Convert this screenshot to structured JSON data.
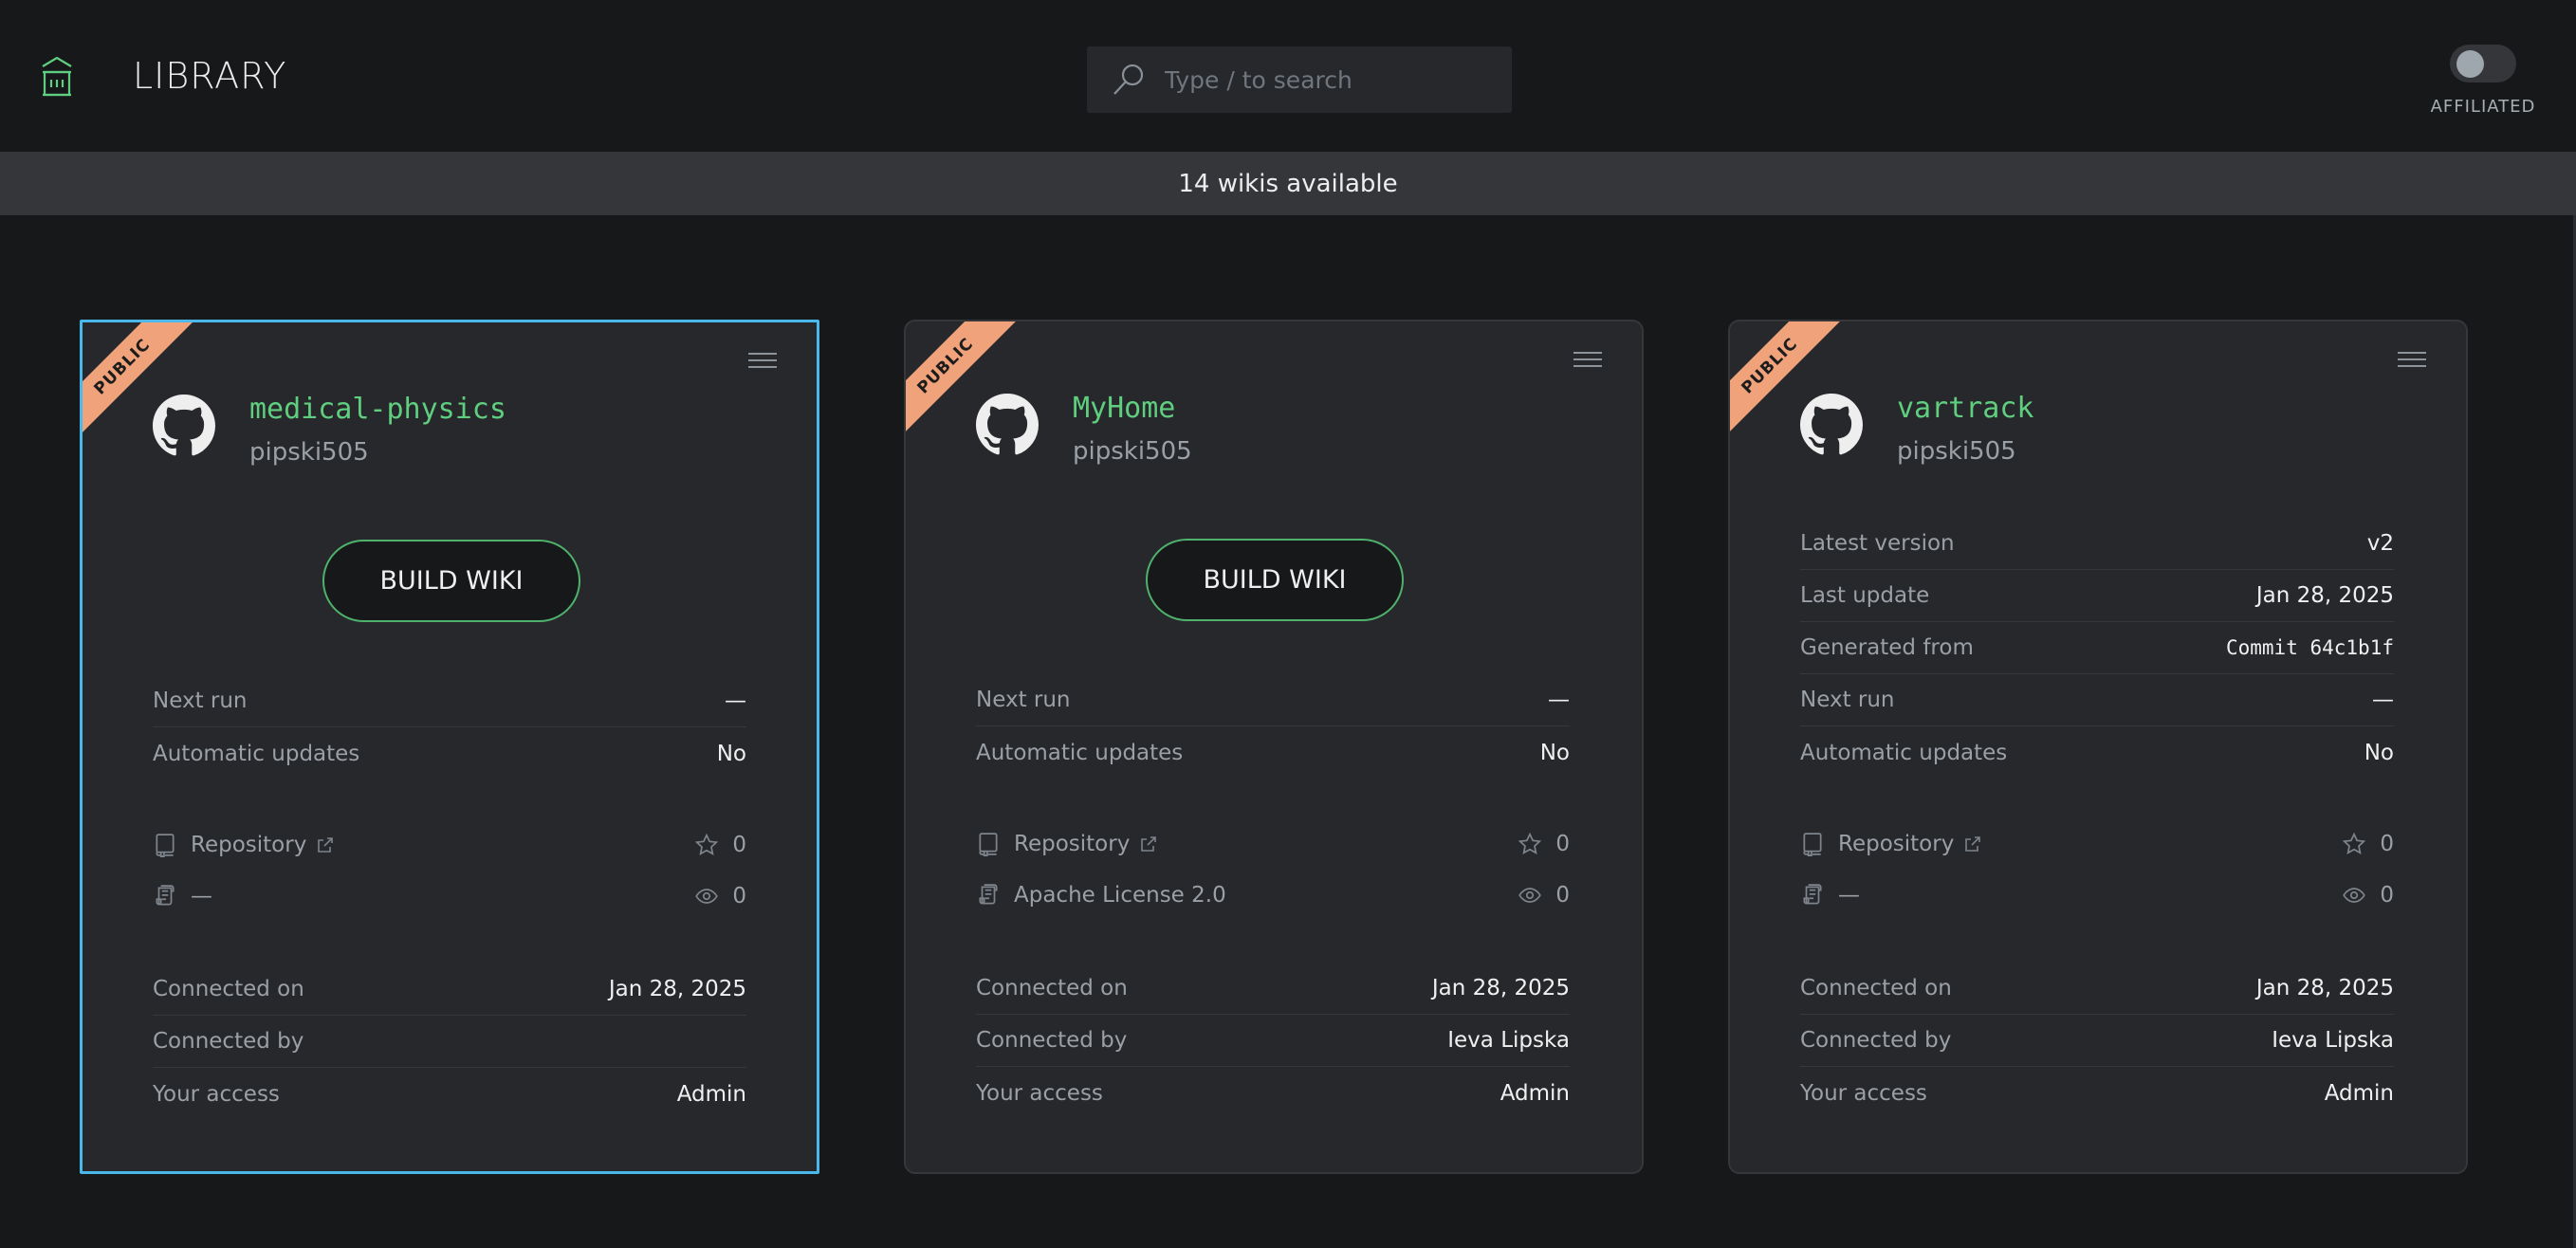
{
  "header": {
    "title": "LIBRARY",
    "logo_icon": "library-building-icon",
    "search": {
      "placeholder": "Type / to search",
      "value": ""
    },
    "toggle": {
      "label": "AFFILIATED",
      "on": false
    }
  },
  "banner": {
    "text": "14 wikis available"
  },
  "colors": {
    "accent_green": "#5fcf7f",
    "selected_border": "#4ab8ea",
    "ribbon": "#f0a27a",
    "background": "#17181a",
    "card": "#27282c"
  },
  "cards": [
    {
      "badge": "PUBLIC",
      "selected": true,
      "title": "medical-physics",
      "owner": "pipski505",
      "build_label": "BUILD WIKI",
      "details": [
        {
          "label": "Next run",
          "value": "—"
        },
        {
          "label": "Automatic updates",
          "value": "No"
        }
      ],
      "repository_label": "Repository",
      "license": "—",
      "stars": "0",
      "watchers": "0",
      "connection": [
        {
          "label": "Connected on",
          "value": "Jan 28, 2025"
        },
        {
          "label": "Connected by",
          "value": ""
        },
        {
          "label": "Your access",
          "value": "Admin"
        }
      ]
    },
    {
      "badge": "PUBLIC",
      "selected": false,
      "title": "MyHome",
      "owner": "pipski505",
      "build_label": "BUILD WIKI",
      "details": [
        {
          "label": "Next run",
          "value": "—"
        },
        {
          "label": "Automatic updates",
          "value": "No"
        }
      ],
      "repository_label": "Repository",
      "license": "Apache License 2.0",
      "stars": "0",
      "watchers": "0",
      "connection": [
        {
          "label": "Connected on",
          "value": "Jan 28, 2025"
        },
        {
          "label": "Connected by",
          "value": "Ieva Lipska"
        },
        {
          "label": "Your access",
          "value": "Admin"
        }
      ]
    },
    {
      "badge": "PUBLIC",
      "selected": false,
      "title": "vartrack",
      "owner": "pipski505",
      "details": [
        {
          "label": "Latest version",
          "value": "v2"
        },
        {
          "label": "Last update",
          "value": "Jan 28, 2025"
        },
        {
          "label": "Generated from",
          "value": "Commit 64c1b1f"
        },
        {
          "label": "Next run",
          "value": "—"
        },
        {
          "label": "Automatic updates",
          "value": "No"
        }
      ],
      "repository_label": "Repository",
      "license": "—",
      "stars": "0",
      "watchers": "0",
      "connection": [
        {
          "label": "Connected on",
          "value": "Jan 28, 2025"
        },
        {
          "label": "Connected by",
          "value": "Ieva Lipska"
        },
        {
          "label": "Your access",
          "value": "Admin"
        }
      ]
    }
  ]
}
